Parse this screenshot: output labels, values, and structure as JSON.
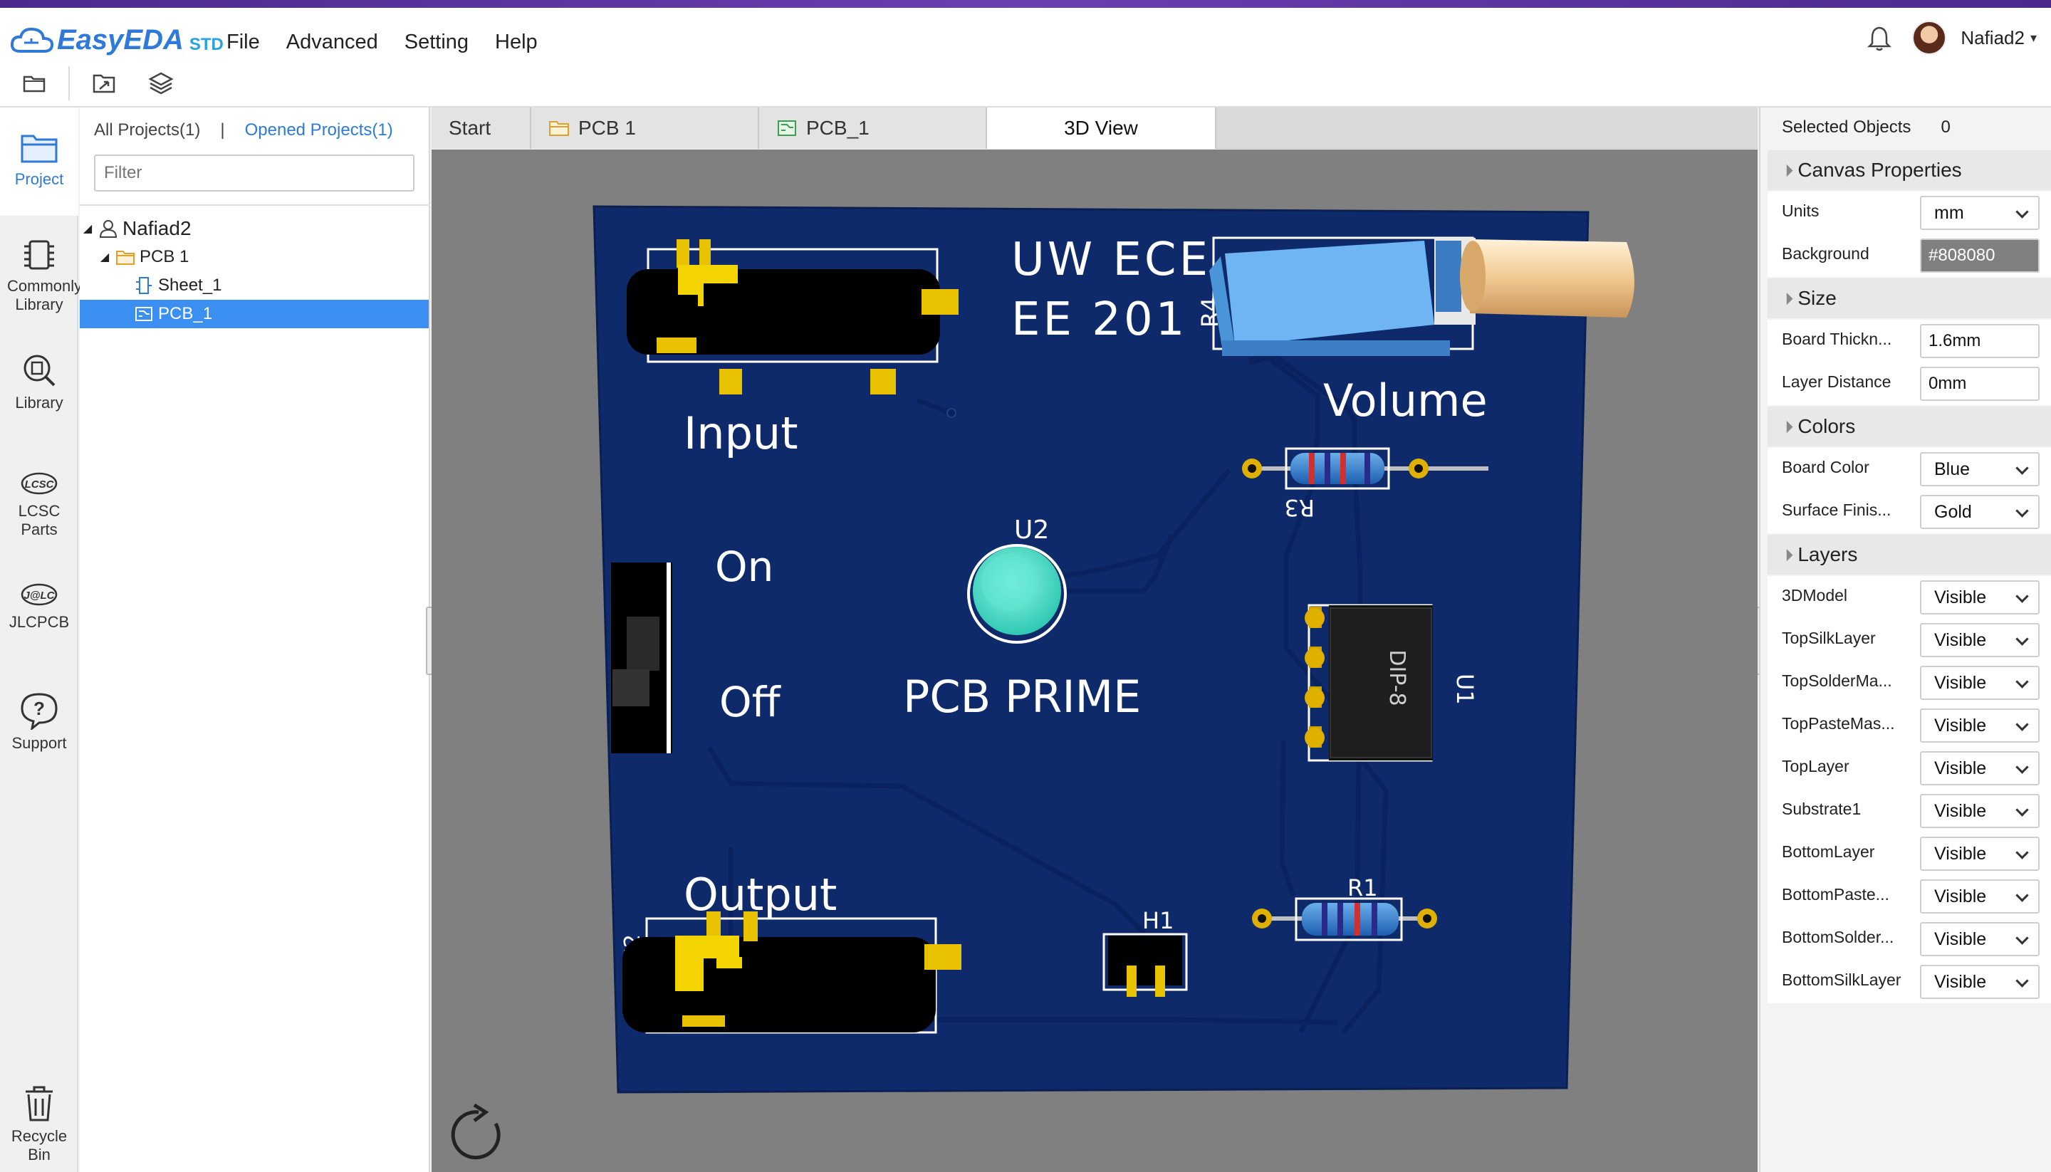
{
  "app": {
    "logo_text": "EasyEDA",
    "logo_badge": "STD",
    "menu": [
      "File",
      "Advanced",
      "Setting",
      "Help"
    ],
    "user": "Nafiad2",
    "brand_color": "#2f7ad8"
  },
  "toolbar": {
    "icons": [
      "folder-icon",
      "export-icon",
      "layers-icon"
    ]
  },
  "rail": {
    "items": [
      {
        "label": "Project",
        "icon": "project-icon",
        "active": true
      },
      {
        "label": "Commonly Library",
        "icon": "chip-icon"
      },
      {
        "label": "Library",
        "icon": "library-search-icon"
      },
      {
        "label": "LCSC Parts",
        "icon": "lcsc-icon"
      },
      {
        "label": "JLCPCB",
        "icon": "jlc-icon"
      },
      {
        "label": "Support",
        "icon": "help-icon"
      },
      {
        "label": "Recycle Bin",
        "icon": "trash-icon"
      }
    ]
  },
  "project_panel": {
    "tab_all": "All Projects(1)",
    "tab_sep": "|",
    "tab_opened": "Opened Projects(1)",
    "filter_placeholder": "Filter",
    "tree": [
      {
        "label": "Nafiad2",
        "icon": "user-icon",
        "level": 0
      },
      {
        "label": "PCB 1",
        "icon": "folder-icon",
        "level": 1
      },
      {
        "label": "Sheet_1",
        "icon": "schematic-icon",
        "level": 2
      },
      {
        "label": "PCB_1",
        "icon": "pcb-icon",
        "level": 2,
        "selected": true
      }
    ]
  },
  "tabs": [
    {
      "label": "Start"
    },
    {
      "label": "PCB 1",
      "icon": "folder-icon"
    },
    {
      "label": "PCB_1",
      "icon": "pcb-icon"
    },
    {
      "label": "3D View",
      "active": true
    }
  ],
  "board": {
    "color": "#0f2a6b",
    "silk_title_1": "UW ECE",
    "silk_title_2": "EE 201",
    "label_input": "Input",
    "label_on": "On",
    "label_off": "Off",
    "label_output": "Output",
    "label_volume": "Volume",
    "label_prime": "PCB PRIME",
    "ref_u2": "U2",
    "ref_r4": "R4",
    "ref_r3": "R3",
    "ref_u1": "U1",
    "ref_r1": "R1",
    "ref_h1": "H1",
    "ref_j2": "J2",
    "chip_text": "DIP-8"
  },
  "properties": {
    "selected_label": "Selected Objects",
    "selected_count": "0",
    "canvas_section": "Canvas Properties",
    "units_label": "Units",
    "units_value": "mm",
    "background_label": "Background",
    "background_value": "#808080",
    "size_section": "Size",
    "thickness_label": "Board Thickn...",
    "thickness_value": "1.6mm",
    "distance_label": "Layer Distance",
    "distance_value": "0mm",
    "colors_section": "Colors",
    "board_color_label": "Board Color",
    "board_color_value": "Blue",
    "surface_label": "Surface Finis...",
    "surface_value": "Gold",
    "layers_section": "Layers",
    "layers": [
      {
        "name": "3DModel",
        "value": "Visible"
      },
      {
        "name": "TopSilkLayer",
        "value": "Visible"
      },
      {
        "name": "TopSolderMa...",
        "value": "Visible"
      },
      {
        "name": "TopPasteMas...",
        "value": "Visible"
      },
      {
        "name": "TopLayer",
        "value": "Visible"
      },
      {
        "name": "Substrate1",
        "value": "Visible"
      },
      {
        "name": "BottomLayer",
        "value": "Visible"
      },
      {
        "name": "BottomPaste...",
        "value": "Visible"
      },
      {
        "name": "BottomSolder...",
        "value": "Visible"
      },
      {
        "name": "BottomSilkLayer",
        "value": "Visible"
      }
    ]
  }
}
